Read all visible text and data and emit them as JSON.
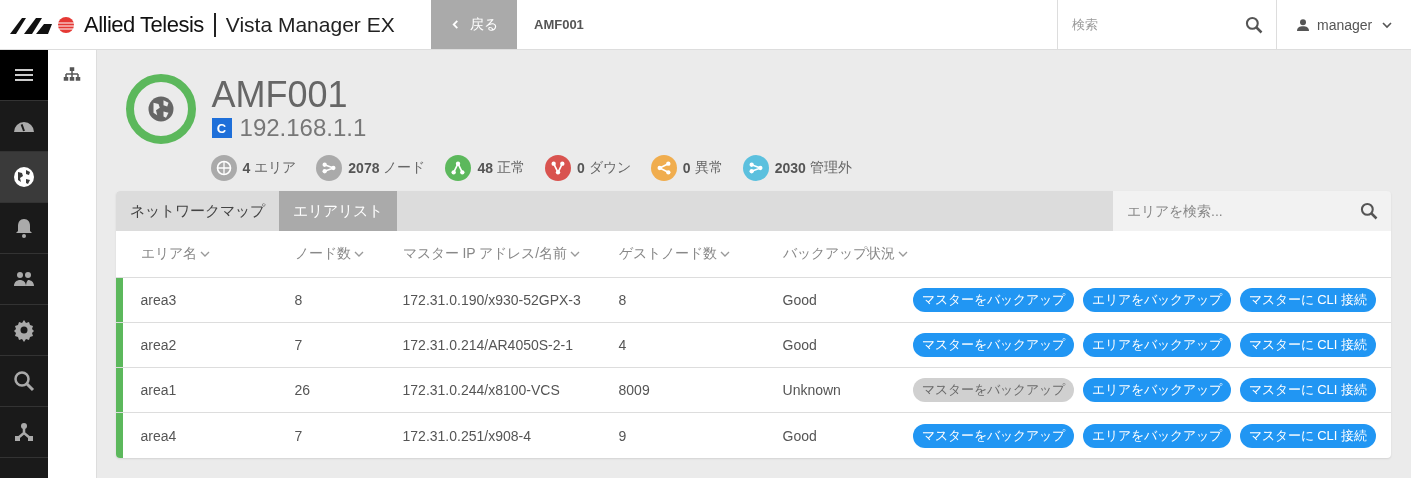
{
  "header": {
    "brand": "Allied Telesis",
    "product": "Vista Manager EX",
    "back_button": "戻る",
    "breadcrumb": "AMF001",
    "search": {
      "placeholder": "検索"
    },
    "user": "manager"
  },
  "nav_rail": [
    {
      "kind": "menu",
      "selected": false
    },
    {
      "kind": "dashboard",
      "selected": false
    },
    {
      "kind": "globe",
      "selected": true
    },
    {
      "kind": "bell",
      "selected": false
    },
    {
      "kind": "users",
      "selected": false
    },
    {
      "kind": "gear",
      "selected": false
    },
    {
      "kind": "search",
      "selected": false
    },
    {
      "kind": "topology",
      "selected": false
    }
  ],
  "device": {
    "name": "AMF001",
    "badge": "C",
    "ip": "192.168.1.1"
  },
  "stats": [
    {
      "kind": "area",
      "count": "4",
      "label": "エリア",
      "color": "#aaaaaa"
    },
    {
      "kind": "node",
      "count": "2078",
      "label": "ノード",
      "color": "#aaaaaa"
    },
    {
      "kind": "up",
      "count": "48",
      "label": "正常",
      "color": "#5cb85c"
    },
    {
      "kind": "down",
      "count": "0",
      "label": "ダウン",
      "color": "#d9534f"
    },
    {
      "kind": "share",
      "count": "0",
      "label": "異常",
      "color": "#f0ad4e"
    },
    {
      "kind": "node",
      "count": "2030",
      "label": "管理外",
      "color": "#5bc0de"
    }
  ],
  "tabs": [
    {
      "label": "ネットワークマップ",
      "selected": false
    },
    {
      "label": "エリアリスト",
      "selected": true
    }
  ],
  "area_search": {
    "placeholder": "エリアを検索..."
  },
  "table": {
    "columns": [
      "エリア名",
      "ノード数",
      "マスター IP アドレス/名前",
      "ゲストノード数",
      "バックアップ状況"
    ],
    "rows": [
      {
        "name": "area3",
        "nodes": "8",
        "master": "172.31.0.190/x930-52GPX-3",
        "guests": "8",
        "backup": "Good",
        "color": "#5cb85c",
        "buttons": [
          {
            "label": "マスターをバックアップ",
            "disabled": false
          },
          {
            "label": "エリアをバックアップ",
            "disabled": false
          },
          {
            "label": "マスターに CLI 接続",
            "disabled": false
          }
        ]
      },
      {
        "name": "area2",
        "nodes": "7",
        "master": "172.31.0.214/AR4050S-2-1",
        "guests": "4",
        "backup": "Good",
        "color": "#5cb85c",
        "buttons": [
          {
            "label": "マスターをバックアップ",
            "disabled": false
          },
          {
            "label": "エリアをバックアップ",
            "disabled": false
          },
          {
            "label": "マスターに CLI 接続",
            "disabled": false
          }
        ]
      },
      {
        "name": "area1",
        "nodes": "26",
        "master": "172.31.0.244/x8100-VCS",
        "guests": "8009",
        "backup": "Unknown",
        "color": "#5cb85c",
        "buttons": [
          {
            "label": "マスターをバックアップ",
            "disabled": true
          },
          {
            "label": "エリアをバックアップ",
            "disabled": false
          },
          {
            "label": "マスターに CLI 接続",
            "disabled": false
          }
        ]
      },
      {
        "name": "area4",
        "nodes": "7",
        "master": "172.31.0.251/x908-4",
        "guests": "9",
        "backup": "Good",
        "color": "#5cb85c",
        "buttons": [
          {
            "label": "マスターをバックアップ",
            "disabled": false
          },
          {
            "label": "エリアをバックアップ",
            "disabled": false
          },
          {
            "label": "マスターに CLI 接続",
            "disabled": false
          }
        ]
      }
    ]
  }
}
